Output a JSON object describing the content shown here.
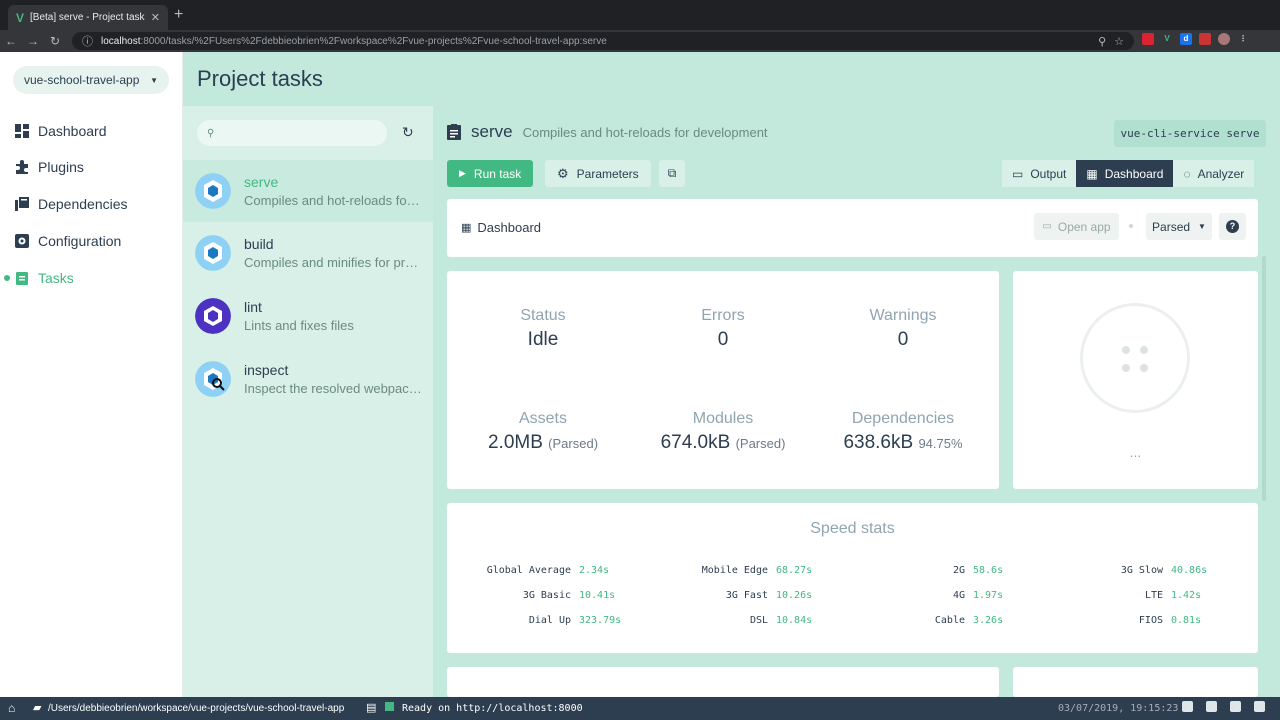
{
  "browser": {
    "tab_title": "[Beta] serve - Project tasks - V",
    "tab_close": "✕",
    "new_tab": "+",
    "url_host": "localhost",
    "url_rest": ":8000/tasks/%2FUsers%2Fdebbieobrien%2Fworkspace%2Fvue-projects%2Fvue-school-travel-app:serve"
  },
  "sidebar": {
    "project_name": "vue-school-travel-app",
    "items": [
      {
        "label": "Dashboard",
        "icon": "dashboard-icon"
      },
      {
        "label": "Plugins",
        "icon": "puzzle-icon"
      },
      {
        "label": "Dependencies",
        "icon": "library-icon"
      },
      {
        "label": "Configuration",
        "icon": "settings-icon"
      },
      {
        "label": "Tasks",
        "icon": "assignment-icon",
        "active": true
      }
    ]
  },
  "header": {
    "title": "Project tasks"
  },
  "tasks": [
    {
      "name": "serve",
      "desc": "Compiles and hot-reloads for development",
      "selected": true
    },
    {
      "name": "build",
      "desc": "Compiles and minifies for production"
    },
    {
      "name": "lint",
      "desc": "Lints and fixes files"
    },
    {
      "name": "inspect",
      "desc": "Inspect the resolved webpack config"
    }
  ],
  "task_detail": {
    "name": "serve",
    "description": "Compiles and hot-reloads for development",
    "command": "vue-cli-service serve",
    "run_label": "Run task",
    "params_label": "Parameters",
    "views": [
      "Output",
      "Dashboard",
      "Analyzer"
    ],
    "active_view": "Dashboard"
  },
  "dashboard": {
    "title": "Dashboard",
    "open_app": "Open app",
    "mode": "Parsed",
    "help": "?",
    "stats": {
      "status_label": "Status",
      "status_value": "Idle",
      "errors_label": "Errors",
      "errors_value": "0",
      "warnings_label": "Warnings",
      "warnings_value": "0",
      "assets_label": "Assets",
      "assets_value": "2.0MB",
      "assets_note": "(Parsed)",
      "modules_label": "Modules",
      "modules_value": "674.0kB",
      "modules_note": "(Parsed)",
      "deps_label": "Dependencies",
      "deps_value": "638.6kB",
      "deps_note": "94.75%"
    },
    "more": "...",
    "speed": {
      "title": "Speed stats",
      "rows": [
        [
          {
            "k": "Global Average",
            "v": "2.34s"
          },
          {
            "k": "Mobile Edge",
            "v": "68.27s"
          },
          {
            "k": "2G",
            "v": "58.6s"
          },
          {
            "k": "3G Slow",
            "v": "40.86s"
          }
        ],
        [
          {
            "k": "3G Basic",
            "v": "10.41s"
          },
          {
            "k": "3G Fast",
            "v": "10.26s"
          },
          {
            "k": "4G",
            "v": "1.97s"
          },
          {
            "k": "LTE",
            "v": "1.42s"
          }
        ],
        [
          {
            "k": "Dial Up",
            "v": "323.79s"
          },
          {
            "k": "DSL",
            "v": "10.84s"
          },
          {
            "k": "Cable",
            "v": "3.26s"
          },
          {
            "k": "FIOS",
            "v": "0.81s"
          }
        ]
      ]
    }
  },
  "statusbar": {
    "path": "/Users/debbieobrien/workspace/vue-projects/vue-school-travel-app",
    "ready": "Ready on http://localhost:8000",
    "time": "03/07/2019, 19:15:23"
  },
  "colors": {
    "accent": "#42b883",
    "dark": "#2c3e50",
    "panel": "#c3e8dc"
  }
}
